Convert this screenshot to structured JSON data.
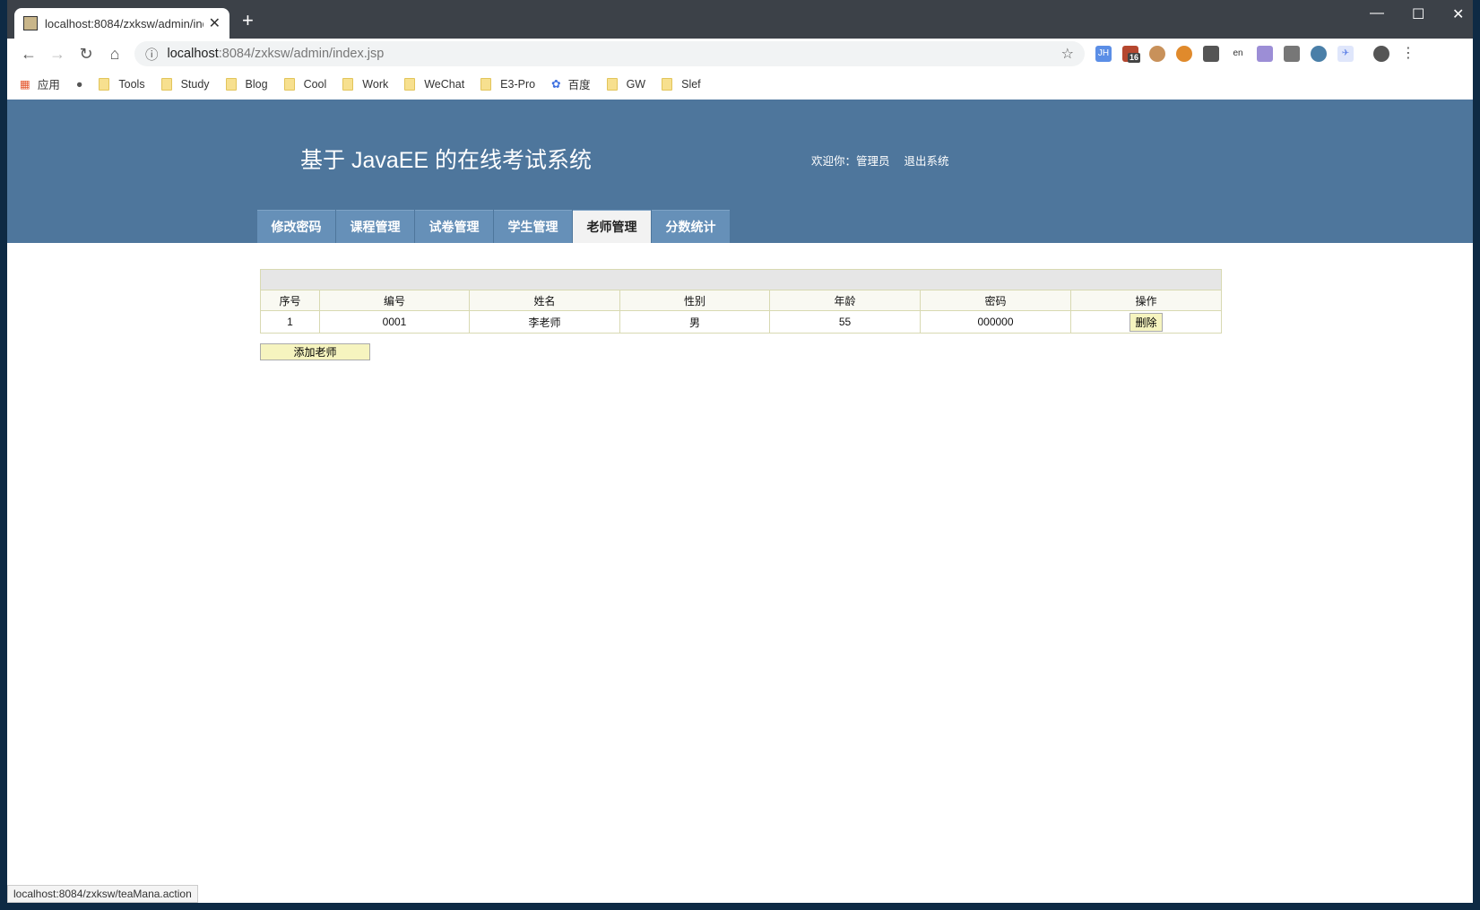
{
  "browser": {
    "tab_title": "localhost:8084/zxksw/admin/index.jsp",
    "url_host": "localhost",
    "url_rest": ":8084/zxksw/admin/index.jsp",
    "bookmarks": [
      "应用",
      "Tools",
      "Study",
      "Blog",
      "Cool",
      "Work",
      "WeChat",
      "E3-Pro",
      "百度",
      "GW",
      "Slef"
    ],
    "ext_badge": "16",
    "status_url": "localhost:8084/zxksw/teaMana.action"
  },
  "header": {
    "title": "基于 JavaEE 的在线考试系统",
    "welcome": "欢迎你：管理员",
    "logout": "退出系统"
  },
  "menu": [
    {
      "label": "修改密码"
    },
    {
      "label": "课程管理"
    },
    {
      "label": "试卷管理"
    },
    {
      "label": "学生管理"
    },
    {
      "label": "老师管理",
      "active": true
    },
    {
      "label": "分数统计"
    }
  ],
  "table": {
    "columns": [
      "序号",
      "编号",
      "姓名",
      "性别",
      "年龄",
      "密码",
      "操作"
    ],
    "rows": [
      [
        "1",
        "0001",
        "李老师",
        "男",
        "55",
        "000000"
      ]
    ],
    "delete_label": "删除"
  },
  "add_button": "添加老师"
}
